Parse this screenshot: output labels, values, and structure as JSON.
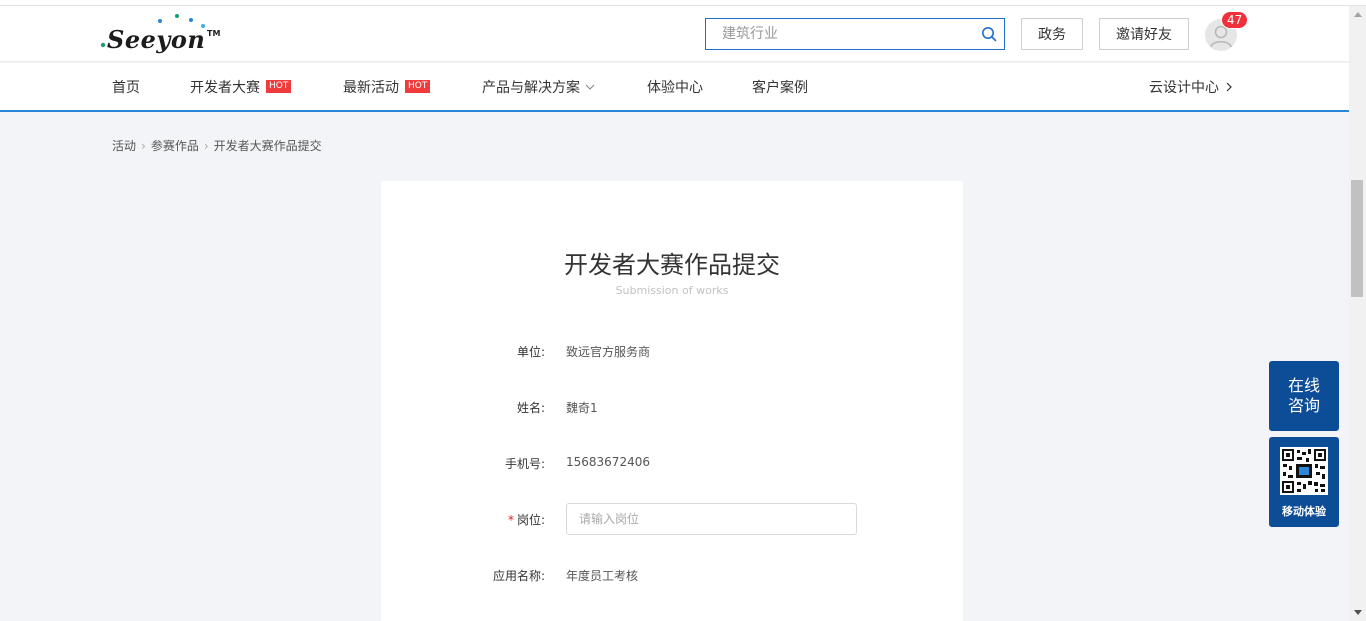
{
  "header": {
    "logo_text": "Seeyon",
    "logo_tm": "TM",
    "search_placeholder": "建筑行业",
    "gov_label": "政务",
    "invite_label": "邀请好友",
    "notification_count": "47"
  },
  "nav": {
    "items": [
      {
        "label": "首页"
      },
      {
        "label": "开发者大赛",
        "hot": "HOT"
      },
      {
        "label": "最新活动",
        "hot": "HOT"
      },
      {
        "label": "产品与解决方案"
      },
      {
        "label": "体验中心"
      },
      {
        "label": "客户案例"
      }
    ],
    "right_label": "云设计中心"
  },
  "breadcrumb": [
    "活动",
    "参赛作品",
    "开发者大赛作品提交"
  ],
  "form": {
    "title": "开发者大赛作品提交",
    "subtitle": "Submission of works",
    "fields": [
      {
        "label": "单位:",
        "value": "致远官方服务商"
      },
      {
        "label": "姓名:",
        "value": "魏奇1"
      },
      {
        "label": "手机号:",
        "value": "15683672406"
      },
      {
        "label": "岗位:",
        "required": "*",
        "placeholder": "请输入岗位"
      },
      {
        "label": "应用名称:",
        "value": "年度员工考核"
      }
    ]
  },
  "floating": {
    "consult_line1": "在线",
    "consult_line2": "咨询",
    "mobile_label": "移动体验"
  },
  "colors": {
    "brand_blue": "#0d4d97",
    "nav_accent": "#2a86d6",
    "hot_red": "#ef3b3b",
    "badge_red": "#f0303a"
  }
}
